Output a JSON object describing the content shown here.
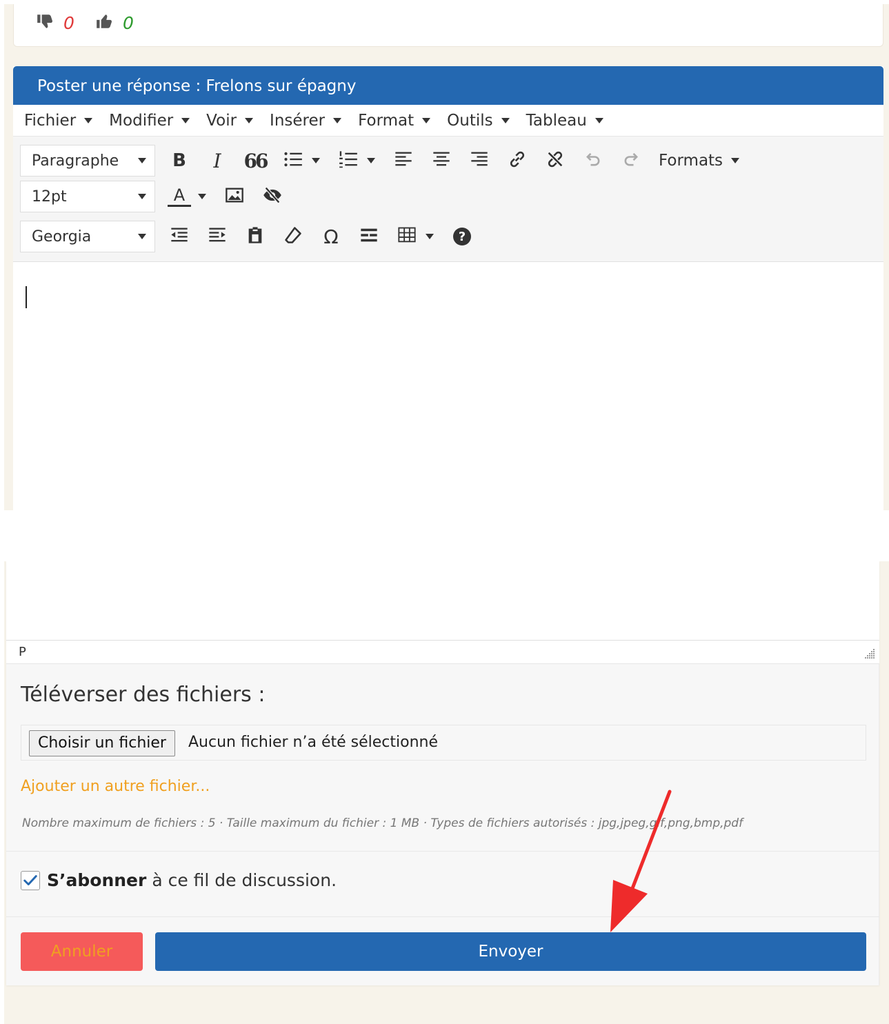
{
  "votes": {
    "dislike_count": "0",
    "like_count": "0"
  },
  "reply_form": {
    "title": "Poster une réponse : Frelons sur épagny"
  },
  "menubar": [
    {
      "label": "Fichier"
    },
    {
      "label": "Modifier"
    },
    {
      "label": "Voir"
    },
    {
      "label": "Insérer"
    },
    {
      "label": "Format"
    },
    {
      "label": "Outils"
    },
    {
      "label": "Tableau"
    }
  ],
  "toolbar": {
    "block_format": "Paragraphe",
    "font_size": "12pt",
    "font_family": "Georgia",
    "formats_label": "Formats",
    "icons": {
      "bold": "B",
      "italic": "I",
      "blockquote": "66",
      "text_color": "A",
      "special_char": "Ω",
      "help": "?"
    }
  },
  "statusbar": {
    "path": "P"
  },
  "upload": {
    "title": "Téléverser des fichiers :",
    "choose_button": "Choisir un fichier",
    "no_file": "Aucun fichier n’a été sélectionné",
    "add_another": "Ajouter un autre fichier...",
    "limits": "Nombre maximum de fichiers : 5 · Taille maximum du fichier : 1 MB · Types de fichiers autorisés : jpg,jpeg,gif,png,bmp,pdf"
  },
  "subscribe": {
    "checked": true,
    "strong": "S’abonner",
    "rest": "à ce fil de discussion."
  },
  "buttons": {
    "cancel": "Annuler",
    "send": "Envoyer"
  },
  "colors": {
    "header_blue": "#2468b1",
    "cancel_red": "#f55a5a",
    "link_orange": "#f0a020",
    "annotation_arrow": "#ee2b2b",
    "dislike_red": "#e03a3a",
    "like_green": "#2e9b2e"
  }
}
